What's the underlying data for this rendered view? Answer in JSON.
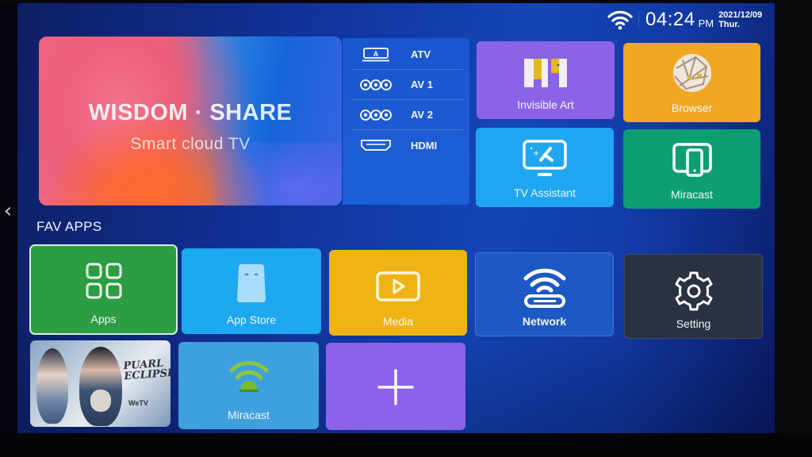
{
  "status": {
    "wifi_icon": "wifi-icon",
    "time": "04:24",
    "ampm": "PM",
    "date": "2021/12/09",
    "weekday": "Thur."
  },
  "nav": {
    "back_icon": "chevron-left-icon",
    "back_glyph": "‹"
  },
  "hero": {
    "title": "WISDOM · SHARE",
    "subtitle": "Smart cloud TV",
    "colors": {
      "pink": "#ec5f7a",
      "orange": "#ff6a2a",
      "blue": "#1565d8"
    }
  },
  "sources": [
    {
      "label": "ATV",
      "icon": "antenna-tv-icon"
    },
    {
      "label": "AV 1",
      "icon": "rca-av-icon"
    },
    {
      "label": "AV 2",
      "icon": "rca-av-icon"
    },
    {
      "label": "HDMI",
      "icon": "hdmi-port-icon"
    }
  ],
  "top_tiles": [
    {
      "label": "Invisible Art",
      "icon": "invisible-art-icon",
      "color": "#8a63e6"
    },
    {
      "label": "Browser",
      "icon": "browser-globe-icon",
      "color": "#f0a722"
    },
    {
      "label": "TV Assistant",
      "icon": "tv-assistant-icon",
      "color": "#1fa6f2"
    },
    {
      "label": "Miracast",
      "icon": "screen-mirror-icon",
      "color": "#0d9f72"
    }
  ],
  "fav_apps": {
    "title": "FAV APPS",
    "row1": [
      {
        "label": "Apps",
        "icon": "apps-grid-icon",
        "color": "#2c9d43",
        "focused": true
      },
      {
        "label": "App Store",
        "icon": "app-store-icon",
        "color": "#1fa8f2"
      },
      {
        "label": "Media",
        "icon": "media-play-icon",
        "color": "#efb413"
      },
      {
        "label": "Network",
        "icon": "network-router-icon",
        "color": "#1d59c4"
      },
      {
        "label": "Setting",
        "icon": "gear-icon",
        "color": "#2a3140"
      }
    ],
    "row2": [
      {
        "label": "",
        "icon": "poster-thumbnail",
        "poster_title_line1": "PUARL",
        "poster_title_line2": "ECLIPSE",
        "poster_brand": "WeTV"
      },
      {
        "label": "Miracast",
        "icon": "miracast-wifi-icon",
        "color": "#3fa0de"
      },
      {
        "label": "",
        "icon": "plus-icon",
        "color": "#8b62ec"
      }
    ]
  }
}
